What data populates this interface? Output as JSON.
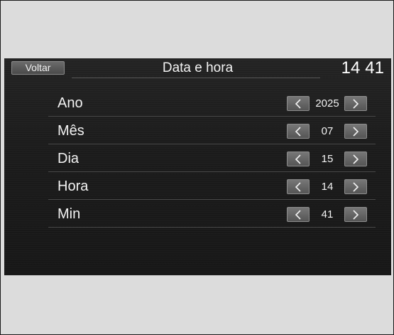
{
  "header": {
    "back_label": "Voltar",
    "title": "Data e hora",
    "clock_hours": "14",
    "clock_minutes": "41"
  },
  "rows": [
    {
      "label": "Ano",
      "value": "2025"
    },
    {
      "label": "Mês",
      "value": "07"
    },
    {
      "label": "Dia",
      "value": "15"
    },
    {
      "label": "Hora",
      "value": "14"
    },
    {
      "label": "Min",
      "value": "41"
    }
  ],
  "icons": {
    "decrease": "chevron-left-icon",
    "increase": "chevron-right-icon"
  },
  "colors": {
    "screen_background": "#1b1b1b",
    "button_background": "#5f5f5f",
    "text": "#f2f2f2"
  }
}
